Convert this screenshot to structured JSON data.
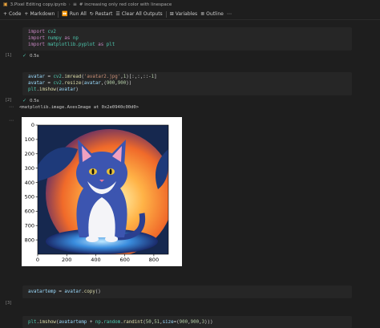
{
  "breadcrumb": {
    "file": "3.Pixel Editing copy.ipynb",
    "section": "# increasing only red color with linespace"
  },
  "toolbar": {
    "code": "Code",
    "markdown": "Markdown",
    "run_all": "Run All",
    "restart": "Restart",
    "clear_outputs": "Clear All Outputs",
    "variables": "Variables",
    "outline": "Outline"
  },
  "cells": [
    {
      "exec_count": "[1]",
      "status_time": "0.5s",
      "lines": [
        [
          {
            "t": "import",
            "c": "kw"
          },
          {
            "t": " ",
            "c": "pl"
          },
          {
            "t": "cv2",
            "c": "mod"
          }
        ],
        [
          {
            "t": "import",
            "c": "kw"
          },
          {
            "t": " ",
            "c": "pl"
          },
          {
            "t": "numpy",
            "c": "mod"
          },
          {
            "t": " as ",
            "c": "kw"
          },
          {
            "t": "np",
            "c": "mod"
          }
        ],
        [
          {
            "t": "import",
            "c": "kw"
          },
          {
            "t": " ",
            "c": "pl"
          },
          {
            "t": "matplotlib.pyplot",
            "c": "mod"
          },
          {
            "t": " as ",
            "c": "kw"
          },
          {
            "t": "plt",
            "c": "mod"
          }
        ]
      ]
    },
    {
      "exec_count": "[2]",
      "status_time": "0.5s",
      "lines": [
        [
          {
            "t": "avatar",
            "c": "var"
          },
          {
            "t": " = ",
            "c": "pl"
          },
          {
            "t": "cv2",
            "c": "mod"
          },
          {
            "t": ".",
            "c": "pl"
          },
          {
            "t": "imread",
            "c": "fn"
          },
          {
            "t": "(",
            "c": "pl"
          },
          {
            "t": "'avatar2.jpg'",
            "c": "str"
          },
          {
            "t": ",",
            "c": "pl"
          },
          {
            "t": "1",
            "c": "num"
          },
          {
            "t": ")[:,:,::-",
            "c": "pl"
          },
          {
            "t": "1",
            "c": "num"
          },
          {
            "t": "]",
            "c": "pl"
          }
        ],
        [
          {
            "t": "avatar",
            "c": "var"
          },
          {
            "t": " = ",
            "c": "pl"
          },
          {
            "t": "cv2",
            "c": "mod"
          },
          {
            "t": ".",
            "c": "pl"
          },
          {
            "t": "resize",
            "c": "fn"
          },
          {
            "t": "(",
            "c": "pl"
          },
          {
            "t": "avatar",
            "c": "var"
          },
          {
            "t": ",(",
            "c": "pl"
          },
          {
            "t": "900",
            "c": "num"
          },
          {
            "t": ",",
            "c": "pl"
          },
          {
            "t": "900",
            "c": "num"
          },
          {
            "t": "))",
            "c": "pl"
          }
        ],
        [
          {
            "t": "plt",
            "c": "mod"
          },
          {
            "t": ".",
            "c": "pl"
          },
          {
            "t": "imshow",
            "c": "fn"
          },
          {
            "t": "(",
            "c": "pl"
          },
          {
            "t": "avatar",
            "c": "var"
          },
          {
            "t": ")",
            "c": "pl"
          }
        ]
      ],
      "output_text": "<matplotlib.image.AxesImage at 0x2e0940c00d0>",
      "plot": {
        "x_ticks": [
          "0",
          "200",
          "400",
          "600",
          "800"
        ],
        "y_ticks": [
          "0",
          "100",
          "200",
          "300",
          "400",
          "500",
          "600",
          "700",
          "800"
        ]
      }
    },
    {
      "exec_count": "[3]",
      "lines": [
        [
          {
            "t": "avatartemp",
            "c": "var"
          },
          {
            "t": " = ",
            "c": "pl"
          },
          {
            "t": "avatar",
            "c": "var"
          },
          {
            "t": ".",
            "c": "pl"
          },
          {
            "t": "copy",
            "c": "fn"
          },
          {
            "t": "()",
            "c": "pl"
          }
        ]
      ]
    },
    {
      "lines": [
        [
          {
            "t": "plt",
            "c": "mod"
          },
          {
            "t": ".",
            "c": "pl"
          },
          {
            "t": "imshow",
            "c": "fn"
          },
          {
            "t": "(",
            "c": "pl"
          },
          {
            "t": "avatartemp",
            "c": "var"
          },
          {
            "t": " + ",
            "c": "pl"
          },
          {
            "t": "np",
            "c": "mod"
          },
          {
            "t": ".",
            "c": "pl"
          },
          {
            "t": "random",
            "c": "mod"
          },
          {
            "t": ".",
            "c": "pl"
          },
          {
            "t": "randint",
            "c": "fn"
          },
          {
            "t": "(",
            "c": "pl"
          },
          {
            "t": "50",
            "c": "num"
          },
          {
            "t": ",",
            "c": "pl"
          },
          {
            "t": "51",
            "c": "num"
          },
          {
            "t": ",",
            "c": "pl"
          },
          {
            "t": "size",
            "c": "var"
          },
          {
            "t": "=(",
            "c": "pl"
          },
          {
            "t": "900",
            "c": "num"
          },
          {
            "t": ",",
            "c": "pl"
          },
          {
            "t": "900",
            "c": "num"
          },
          {
            "t": ",",
            "c": "pl"
          },
          {
            "t": "3",
            "c": "num"
          },
          {
            "t": ")))",
            "c": "pl"
          }
        ]
      ]
    }
  ],
  "colors": {
    "background": "#1e1e1e",
    "cell_background": "#262626",
    "success_check": "#4ec9b0",
    "keyword": "#c586c0"
  }
}
